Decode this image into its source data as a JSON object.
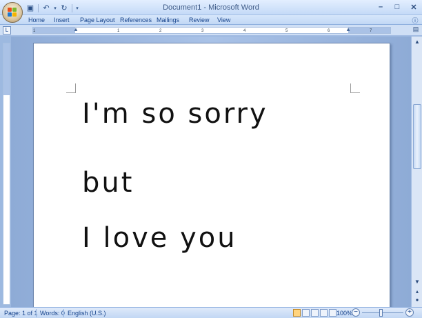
{
  "window": {
    "title": "Document1 - Microsoft Word"
  },
  "quick_access": {
    "icons": [
      "save-icon",
      "undo-icon",
      "redo-icon",
      "customize-icon"
    ]
  },
  "ribbon": {
    "tabs": [
      "Home",
      "Insert",
      "Page Layout",
      "References",
      "Mailings",
      "Review",
      "View"
    ]
  },
  "ruler": {
    "ticks": [
      "1",
      "1",
      "2",
      "3",
      "4",
      "5",
      "6",
      "7"
    ]
  },
  "document": {
    "lines": [
      "I'm so sorry",
      "but",
      "I love you"
    ]
  },
  "status": {
    "page": "Page: 1 of 1",
    "words": "Words: 0",
    "language": "English (U.S.)",
    "zoom": "100%"
  },
  "colors": {
    "accent": "#15428b",
    "page_bg": "#ffffff",
    "workspace": "#a9c2e7"
  }
}
